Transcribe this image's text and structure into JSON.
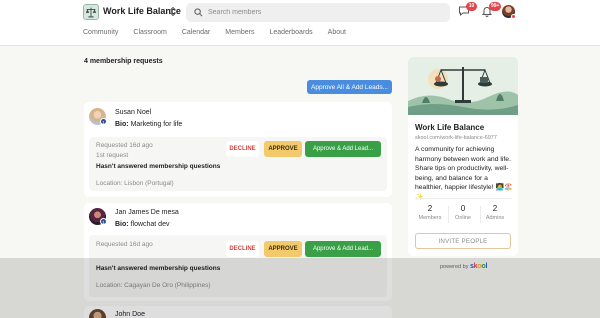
{
  "header": {
    "group_name": "Work Life Balance",
    "search_placeholder": "Search members",
    "chat_badge": "10",
    "notification_badge": "99+"
  },
  "nav": {
    "items": [
      {
        "label": "Community"
      },
      {
        "label": "Classroom"
      },
      {
        "label": "Calendar"
      },
      {
        "label": "Members"
      },
      {
        "label": "Leaderboards"
      },
      {
        "label": "About"
      }
    ]
  },
  "main": {
    "request_count": "4 membership requests",
    "approve_all_label": "Approve All & Add Leads...",
    "requests": [
      {
        "name": "Susan Noel",
        "bio_label": "Bio:",
        "bio": "Marketing for life",
        "level": "1",
        "requested": "Requested 16d ago",
        "request_number": "1st request",
        "question_status": "Hasn't answered membership questions",
        "location": "Location: Lisbon (Portugal)"
      },
      {
        "name": "Jan James De mesa",
        "bio_label": "Bio:",
        "bio": "flowchat dev",
        "level": "1",
        "requested": "Requested 16d ago",
        "question_status": "Hasn't answered membership questions",
        "location": "Location: Cagayan De Oro (Philippines)"
      },
      {
        "name": "John Doe"
      }
    ],
    "decline_label": "DECLINE",
    "approve_label": "APPROVE",
    "approve_add_label": "Approve & Add Lead..."
  },
  "sidebar": {
    "title": "Work Life Balance",
    "url": "skool.com/work-life-balance-6977",
    "description": "A community for achieving harmony between work and life. Share tips on productivity, well-being, and balance for a healthier, happier lifestyle! 👩‍💻🏖️✨",
    "stats": [
      {
        "value": "2",
        "label": "Members"
      },
      {
        "value": "0",
        "label": "Online"
      },
      {
        "value": "2",
        "label": "Admins"
      }
    ],
    "invite_label": "INVITE PEOPLE",
    "powered_by": "powered by",
    "brand": "skool"
  },
  "colors": {
    "primary_blue": "#4a8ddf",
    "approve_yellow": "#f2c96b",
    "approve_add_green": "#3aa048",
    "decline_red": "#d0453f",
    "badge_red": "#e0464c"
  },
  "icons": {
    "group_logo": "scale-logo",
    "switcher": "chevron-up-down-icon",
    "search": "search-icon",
    "chat": "chat-icon",
    "notifications": "bell-icon"
  }
}
